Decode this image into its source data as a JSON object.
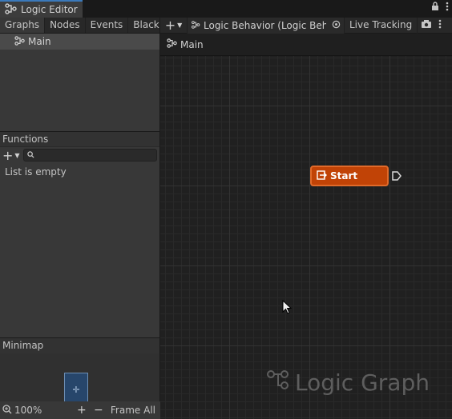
{
  "window": {
    "title": "Logic Editor",
    "icons": {
      "graph": "graph-icon",
      "lock": "lock-icon",
      "menu": "kebab-menu-icon"
    }
  },
  "left_panel": {
    "tabs": [
      {
        "label": "Graphs",
        "active": true
      },
      {
        "label": "Nodes",
        "active": false
      },
      {
        "label": "Events",
        "active": false
      },
      {
        "label": "Blackb",
        "active": false
      }
    ],
    "graphs": [
      {
        "label": "Main"
      }
    ],
    "functions": {
      "header": "Functions",
      "search_placeholder": "",
      "empty_text": "List is empty"
    },
    "minimap": {
      "header": "Minimap",
      "zoom": "100%",
      "frame_all": "Frame All"
    }
  },
  "right_panel": {
    "toolbar": {
      "asset_label": "Logic Behavior (Logic Behav",
      "live_tracking": "Live Tracking"
    },
    "breadcrumb": "Main",
    "node": {
      "label": "Start",
      "color": "#c14306"
    },
    "watermark": "Logic Graph"
  }
}
